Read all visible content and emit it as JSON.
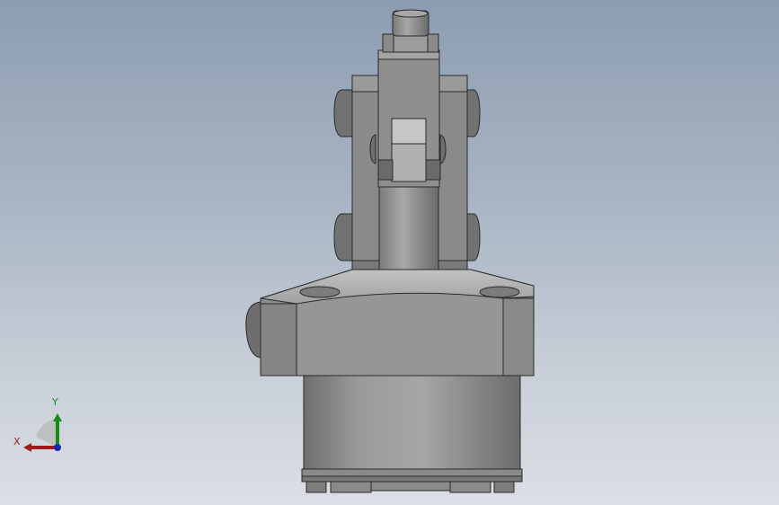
{
  "viewport": {
    "colors": {
      "background_top": "#8d9db1",
      "background_bottom": "#dcdfe5",
      "part_body": "#8e8e8e",
      "part_highlight": "#b4b4b4",
      "part_shadow": "#5a5a5a"
    }
  },
  "model": {
    "name": "",
    "icon": "cylinder-clamp-part"
  },
  "triad": {
    "x_label": "X",
    "y_label": "Y",
    "x_color": "#a01818",
    "y_color": "#1a8a1a",
    "z_color": "#1a2ab0"
  }
}
